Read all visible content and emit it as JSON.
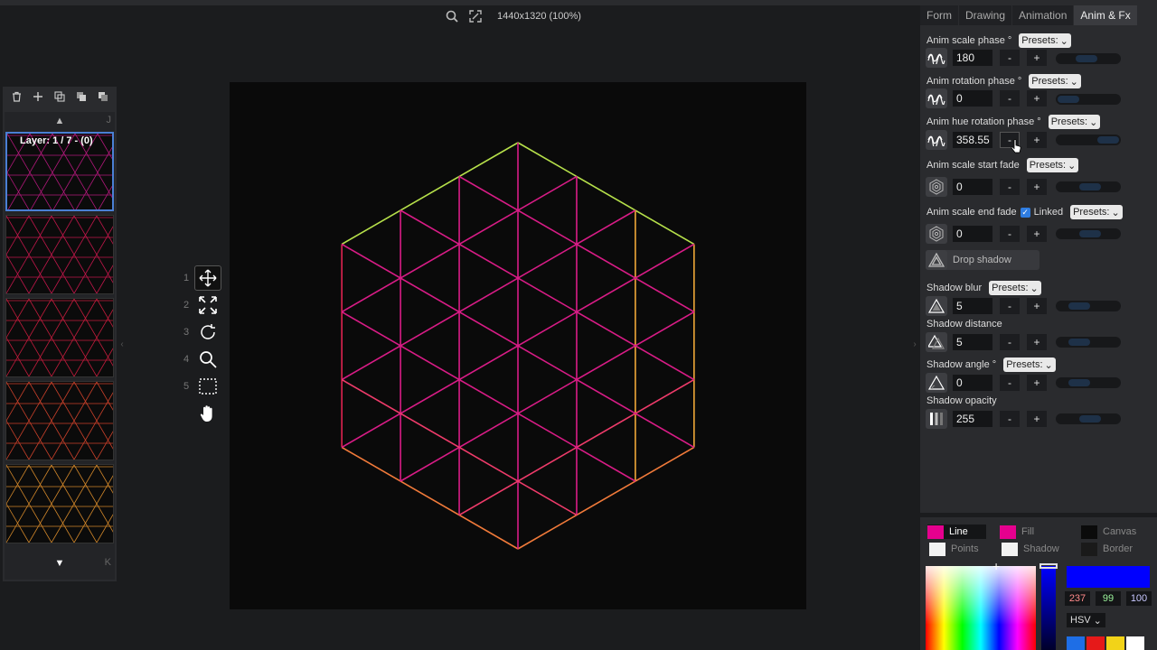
{
  "header": {
    "canvas_size": "1440x1320 (100%)",
    "icons": [
      "magnifier-icon",
      "fit-screen-icon"
    ]
  },
  "layers": {
    "toolbar_icons": [
      "trash-icon",
      "plus-icon",
      "duplicate-icon",
      "merge-icon",
      "copy-icon"
    ],
    "nav_up_key": "J",
    "nav_down_key": "K",
    "current_label": "Layer: 1 / 7 - (0)",
    "thumb_colors": [
      "#b0187a",
      "#c0174a",
      "#c21c3c",
      "#c8402a",
      "#d0862a"
    ]
  },
  "tools": [
    {
      "num": "1",
      "icon": "move-icon"
    },
    {
      "num": "2",
      "icon": "scale-icon"
    },
    {
      "num": "3",
      "icon": "rotate-icon"
    },
    {
      "num": "4",
      "icon": "zoom-icon"
    },
    {
      "num": "5",
      "icon": "select-rect-icon"
    },
    {
      "num": "",
      "icon": "hand-icon"
    }
  ],
  "tabs": [
    "Form",
    "Drawing",
    "Animation",
    "Anim & Fx"
  ],
  "active_tab": "Anim & Fx",
  "anim": {
    "presets_label": "Presets:",
    "minus": "-",
    "plus": "+",
    "scale_phase": {
      "label": "Anim scale phase °",
      "value": "180"
    },
    "rotation_phase": {
      "label": "Anim rotation phase °",
      "value": "0"
    },
    "hue_rotation_phase": {
      "label": "Anim hue rotation phase °",
      "value": "358.55"
    },
    "scale_start_fade": {
      "label": "Anim scale start fade",
      "value": "0"
    },
    "scale_end_fade": {
      "label": "Anim scale end fade",
      "value": "0",
      "linked_label": "Linked",
      "linked_checked": true
    }
  },
  "shadow": {
    "drop_shadow_label": "Drop shadow",
    "blur": {
      "label": "Shadow blur",
      "value": "5"
    },
    "distance": {
      "label": "Shadow distance",
      "value": "5"
    },
    "angle": {
      "label": "Shadow angle °",
      "value": "0"
    },
    "opacity": {
      "label": "Shadow opacity",
      "value": "255"
    }
  },
  "colors": {
    "line": {
      "label": "Line",
      "color": "#e5008e"
    },
    "fill": {
      "label": "Fill",
      "color": "#e5008e"
    },
    "canvas": {
      "label": "Canvas",
      "color": "#0b0b0b"
    },
    "points": {
      "label": "Points",
      "color": "#f2f2f2"
    },
    "shadow": {
      "label": "Shadow",
      "color": "#f2f2f2"
    },
    "border": {
      "label": "Border",
      "color": "#1a1a1a"
    },
    "preview": "#0000ff",
    "r": "237",
    "g": "99",
    "b": "100",
    "mode": "HSV",
    "palette": [
      "#1e6ee6",
      "#e61919",
      "#f2d318",
      "#ffffff"
    ]
  }
}
